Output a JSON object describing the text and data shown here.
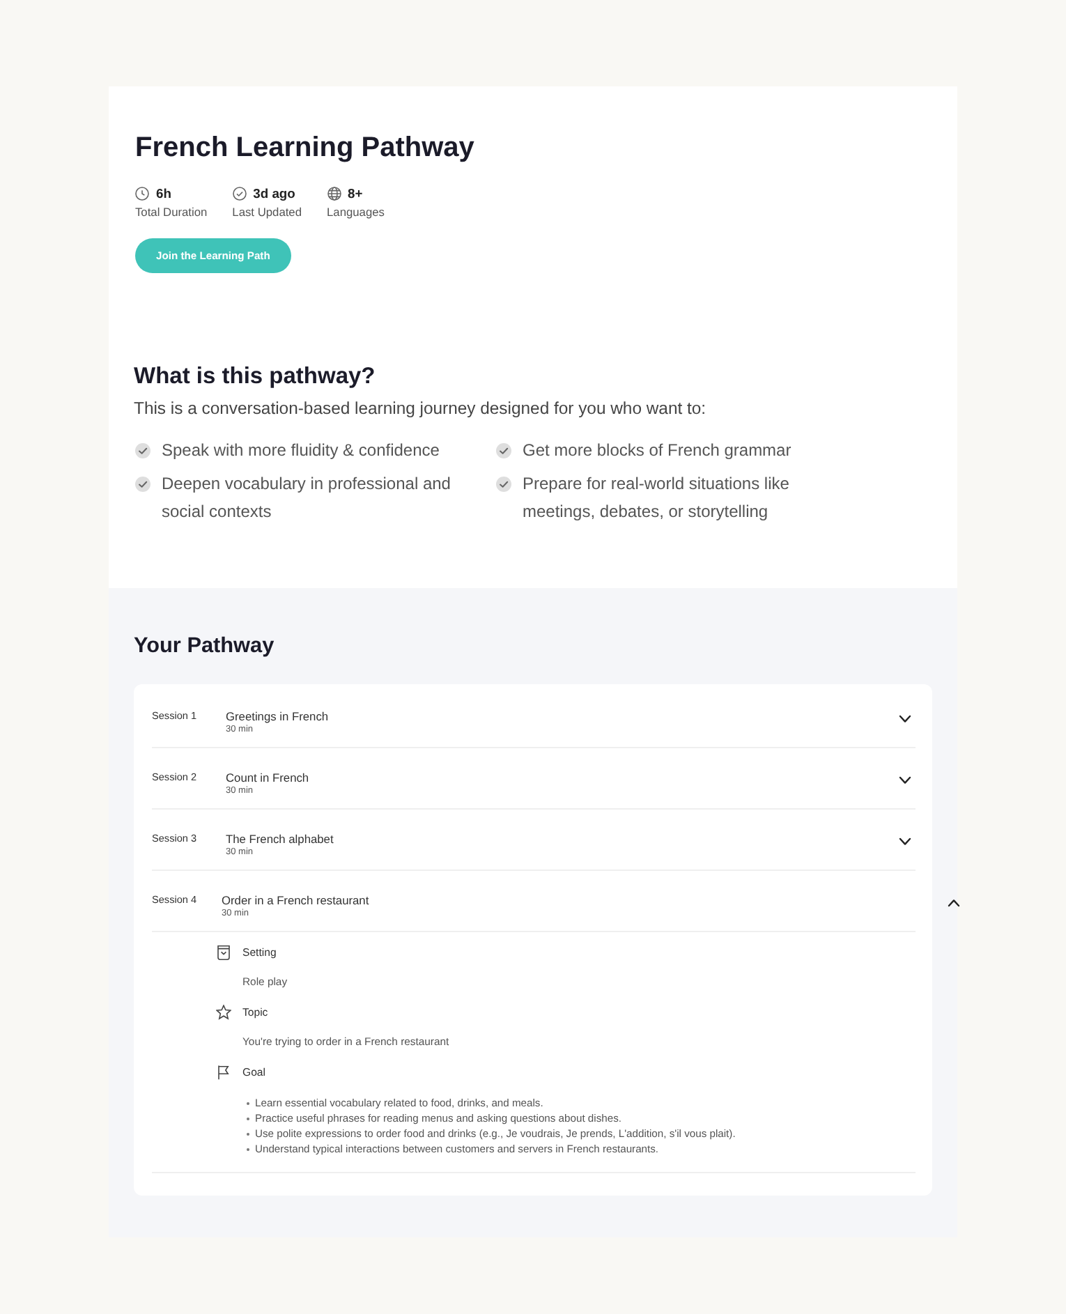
{
  "header": {
    "title": "French Learning Pathway",
    "stats": [
      {
        "kind": "clock",
        "value": "6h",
        "label": "Total Duration"
      },
      {
        "kind": "check",
        "value": "3d ago",
        "label": "Last Updated"
      },
      {
        "kind": "globe",
        "value": "8+",
        "label": "Languages"
      }
    ],
    "button": "Join the Learning Path"
  },
  "about": {
    "heading": "What is this pathway?",
    "intro": "This is a conversation-based learning journey designed for you who want to:",
    "goals": [
      "Speak with more fluidity & confidence",
      "Get more blocks of French grammar",
      "Deepen vocabulary in professional and social contexts",
      "Prepare for real-world situations like meetings, debates, or storytelling"
    ]
  },
  "pathway": {
    "heading": "Your Pathway",
    "sessions": [
      {
        "label": "Session 1",
        "title": "Greetings in French",
        "duration": "30 min",
        "expanded": false
      },
      {
        "label": "Session 2",
        "title": "Count in French",
        "duration": "30 min",
        "expanded": false
      },
      {
        "label": "Session 3",
        "title": "The French alphabet",
        "duration": "30 min",
        "expanded": false
      },
      {
        "label": "Session 4",
        "title": "Order in a French restaurant",
        "duration": "30 min",
        "expanded": true,
        "details": [
          {
            "kind": "setting",
            "label": "Setting",
            "text": "Role play"
          },
          {
            "kind": "topic",
            "label": "Topic",
            "text": "You're trying to order in a French restaurant"
          },
          {
            "kind": "goal",
            "label": "Goal",
            "items": [
              "Learn essential vocabulary related to food, drinks, and meals.",
              "Practice useful phrases for reading menus and asking questions about dishes.",
              "Use polite expressions to order food and drinks (e.g., Je voudrais, Je prends, L'addition, s'il vous plait).",
              "Understand typical interactions between customers and servers in French restaurants."
            ]
          }
        ]
      }
    ]
  }
}
